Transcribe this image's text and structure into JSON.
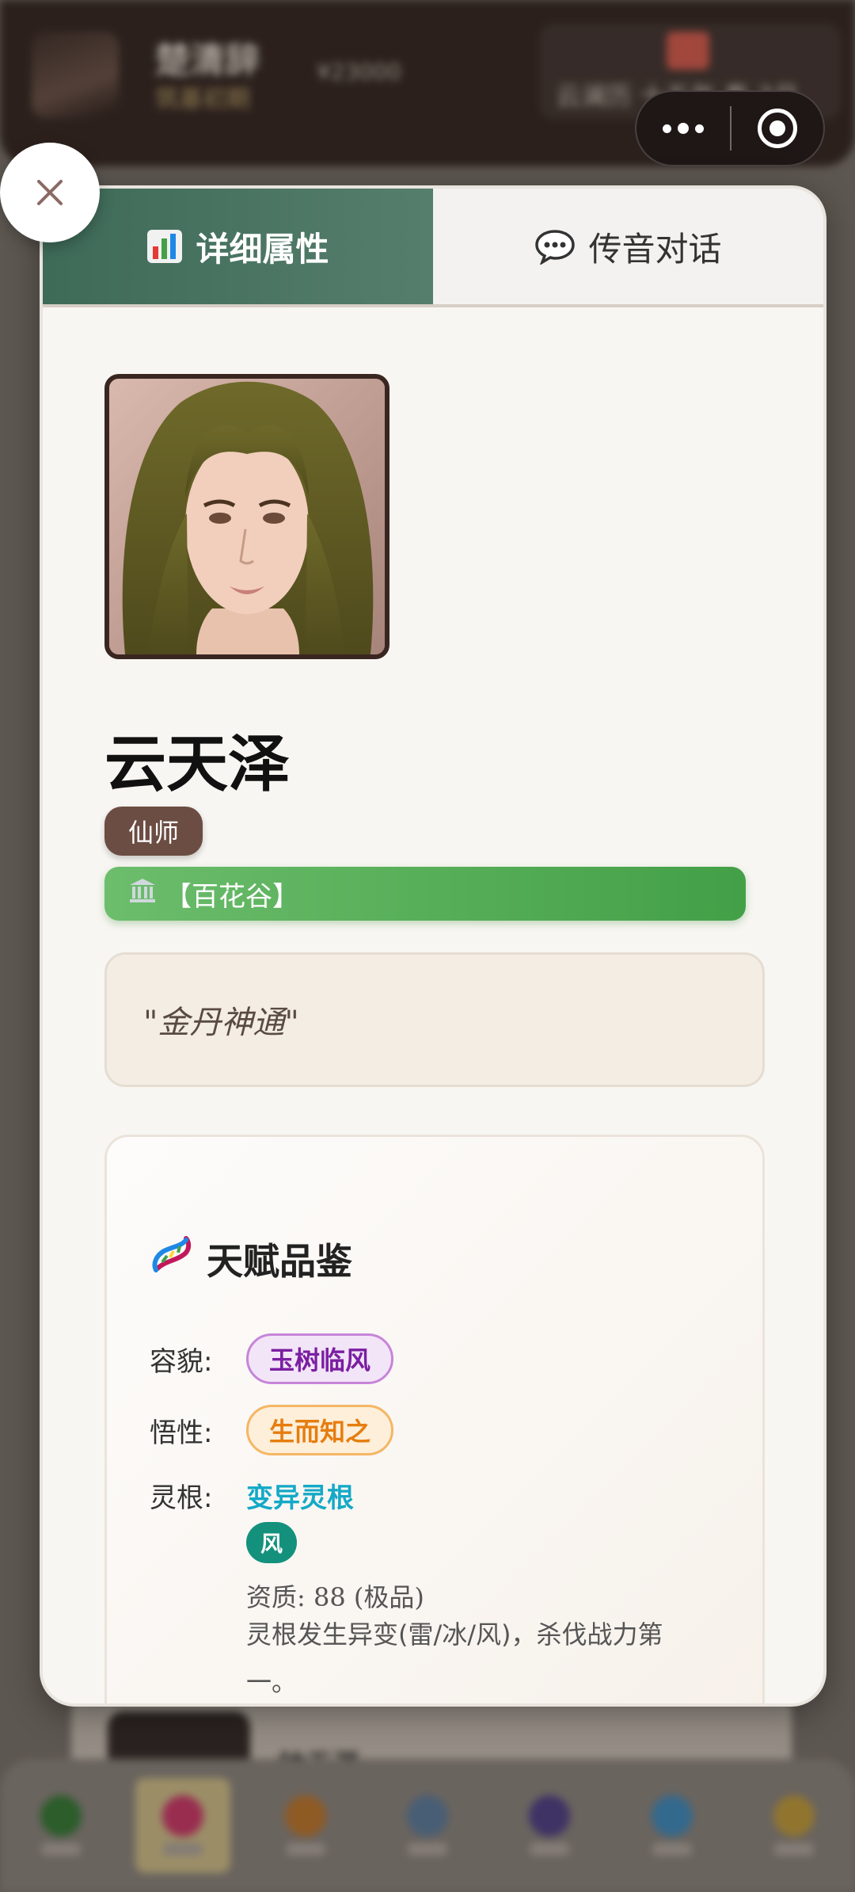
{
  "background": {
    "header": {
      "user_name": "楚清辞",
      "user_realm": "筑基初期",
      "spirit_stones": "¥23000",
      "calendar_text": "云澜历 十五年 春 3月"
    },
    "list_item_title": "钟无涯",
    "nav_items": [
      "家族",
      "姻缘",
      "修炼",
      "斗法",
      "宗门",
      "阵法",
      "公告"
    ]
  },
  "modal": {
    "tabs": [
      {
        "label": "详细属性",
        "icon": "bar-chart-icon"
      },
      {
        "label": "传音对话",
        "icon": "speech-bubble-icon"
      }
    ],
    "character": {
      "name": "云天泽",
      "role": "仙师",
      "sect": "【百花谷】",
      "quote": "\"金丹神通\""
    },
    "talent": {
      "title": "天赋品鉴",
      "looks_label": "容貌:",
      "looks_value": "玉树临风",
      "comprehension_label": "悟性:",
      "comprehension_value": "生而知之",
      "root_label": "灵根:",
      "root_value": "变异灵根",
      "root_element": "风",
      "aptitude": "资质: 88 (极品)",
      "description": "灵根发生异变(雷/冰/风)，杀伐战力第一。"
    }
  },
  "colors": {
    "active_tab": "#4a7463",
    "role_badge": "#6c4d43",
    "sect_bar": "#4caf50",
    "tag_purple": "#7b1fa2",
    "tag_orange": "#e67d0f",
    "root_cyan": "#14a9c7",
    "element_teal": "#14917d"
  }
}
